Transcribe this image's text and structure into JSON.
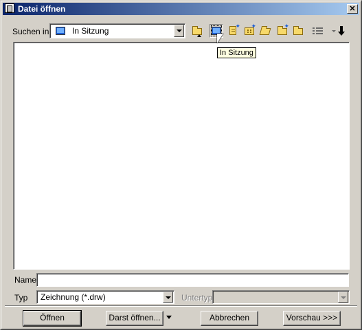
{
  "window": {
    "title": "Datei öffnen"
  },
  "toolbar": {
    "look_in_label": "Suchen in",
    "look_in_value": "In Sitzung",
    "buttons": [
      {
        "icon": "folder-up-icon"
      },
      {
        "icon": "in-session-icon",
        "pressed": true
      },
      {
        "icon": "new-doc-icon"
      },
      {
        "icon": "new-folder-star-icon"
      },
      {
        "icon": "open-folder-icon"
      },
      {
        "icon": "new-folder-icon"
      },
      {
        "icon": "working-directory-icon"
      },
      {
        "icon": "list-view-icon"
      },
      {
        "icon": "command-icon"
      }
    ],
    "tooltip": "In Sitzung"
  },
  "name_row": {
    "label": "Name",
    "value": ""
  },
  "type_row": {
    "label": "Typ",
    "value": "Zeichnung (*.drw)",
    "subtype_label": "Untertyp",
    "subtype_value": ""
  },
  "buttons": {
    "open": "Öffnen",
    "open_rep": "Darst öffnen...",
    "cancel": "Abbrechen",
    "preview": "Vorschau >>>"
  },
  "colors": {
    "titlebar_start": "#0a246a",
    "titlebar_end": "#a6caf0",
    "dialog_bg": "#d4d0c8",
    "tooltip_bg": "#ffffe1"
  }
}
